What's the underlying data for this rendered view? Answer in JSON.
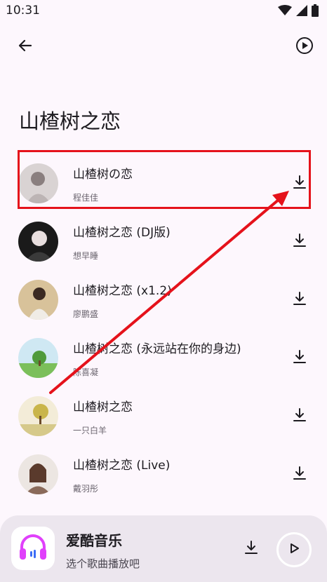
{
  "status_bar": {
    "time": "10:31",
    "icons": [
      "wifi-icon",
      "signal-icon",
      "battery-icon"
    ]
  },
  "header": {
    "back_icon": "arrow-left-icon",
    "play_all_icon": "play-circle-icon"
  },
  "page": {
    "title": "山楂树之恋"
  },
  "songs": [
    {
      "title": "山楂树の恋",
      "artist": "程佳佳"
    },
    {
      "title": "山楂树之恋 (DJ版)",
      "artist": "想早睡"
    },
    {
      "title": "山楂树之恋 (x1.2)",
      "artist": "廖鹏盛"
    },
    {
      "title": "山楂树之恋 (永远站在你的身边)",
      "artist": "陈喜凝"
    },
    {
      "title": "山楂树之恋",
      "artist": "一只白羊"
    },
    {
      "title": "山楂树之恋 (Live)",
      "artist": "戴羽彤"
    }
  ],
  "player": {
    "title": "爱酷音乐",
    "subtitle": "选个歌曲播放吧"
  },
  "colors": {
    "background": "#fdf7fd",
    "player_background": "#ece6ee",
    "highlight": "#e5121b",
    "accent": "#e040fb"
  }
}
